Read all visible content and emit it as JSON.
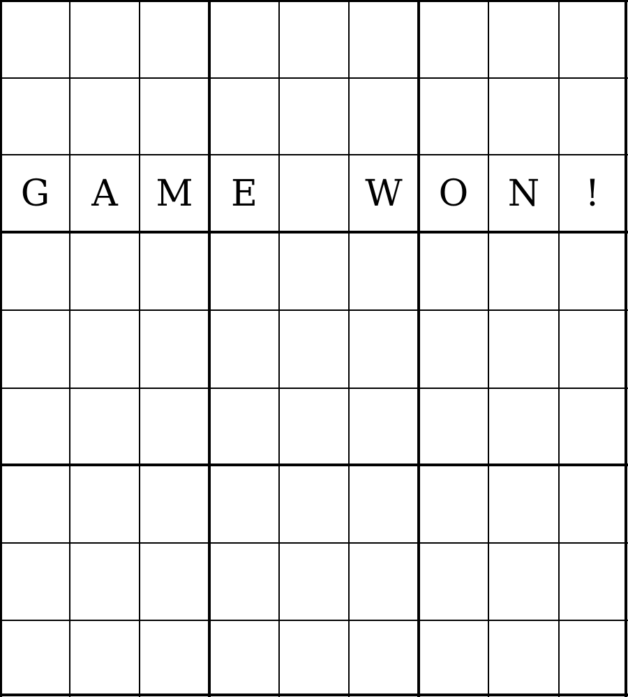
{
  "grid": {
    "rows": [
      [
        "",
        "",
        "",
        "",
        "",
        "",
        "",
        "",
        ""
      ],
      [
        "",
        "",
        "",
        "",
        "",
        "",
        "",
        "",
        ""
      ],
      [
        "G",
        "A",
        "M",
        "E",
        "",
        "W",
        "O",
        "N",
        "!"
      ],
      [
        "",
        "",
        "",
        "",
        "",
        "",
        "",
        "",
        ""
      ],
      [
        "",
        "",
        "",
        "",
        "",
        "",
        "",
        "",
        ""
      ],
      [
        "",
        "",
        "",
        "",
        "",
        "",
        "",
        "",
        ""
      ],
      [
        "",
        "",
        "",
        "",
        "",
        "",
        "",
        "",
        ""
      ],
      [
        "",
        "",
        "",
        "",
        "",
        "",
        "",
        "",
        ""
      ],
      [
        "",
        "",
        "",
        "",
        "",
        "",
        "",
        "",
        ""
      ]
    ]
  },
  "colors": {
    "line": "#000000",
    "background": "#ffffff",
    "text": "#000000"
  }
}
